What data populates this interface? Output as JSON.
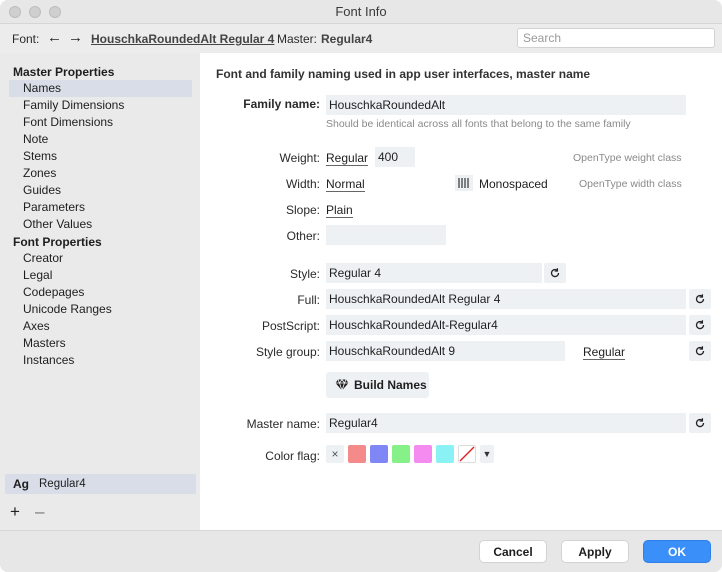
{
  "window": {
    "title": "Font Info"
  },
  "toolbar": {
    "font_label": "Font:",
    "font_name": "HouschkaRoundedAlt Regular 4",
    "master_label": "Master:",
    "master_value": "Regular4",
    "search_placeholder": "Search"
  },
  "sidebar": {
    "master_section": "Master Properties",
    "master_items": [
      "Names",
      "Family Dimensions",
      "Font Dimensions",
      "Note",
      "Stems",
      "Zones",
      "Guides",
      "Parameters",
      "Other Values"
    ],
    "font_section": "Font Properties",
    "font_items": [
      "Creator",
      "Legal",
      "Codepages",
      "Unicode Ranges",
      "Axes",
      "Masters",
      "Instances"
    ],
    "selected": "Names",
    "master_preview": "Ag",
    "master_name": "Regular4",
    "add_label": "+",
    "remove_label": "–"
  },
  "main": {
    "heading": "Font and family naming used in app user interfaces, master name",
    "family_name_label": "Family name:",
    "family_name_value": "HouschkaRoundedAlt",
    "family_name_hint": "Should be identical across all fonts that belong to the same family",
    "weight_label": "Weight:",
    "weight_value": "Regular",
    "weight_number": "400",
    "weight_hint": "OpenType weight class",
    "width_label": "Width:",
    "width_value": "Normal",
    "monospaced_label": "Monospaced",
    "width_hint": "OpenType width class",
    "slope_label": "Slope:",
    "slope_value": "Plain",
    "other_label": "Other:",
    "other_value": "",
    "style_label": "Style:",
    "style_value": "Regular 4",
    "full_label": "Full:",
    "full_value": "HouschkaRoundedAlt Regular 4",
    "postscript_label": "PostScript:",
    "postscript_value": "HouschkaRoundedAlt-Regular4",
    "style_group_label": "Style group:",
    "style_group_value": "HouschkaRoundedAlt 9",
    "style_group_link": "Regular",
    "build_names_label": "Build Names",
    "master_name_label": "Master name:",
    "master_name_value": "Regular4",
    "color_flag_label": "Color flag:",
    "color_flag_clear": "×",
    "color_flag_colors": [
      "#f48a8a",
      "#7f86f5",
      "#86f089",
      "#f58af0",
      "#8af2f4"
    ]
  },
  "footer": {
    "cancel_label": "Cancel",
    "apply_label": "Apply",
    "ok_label": "OK"
  }
}
